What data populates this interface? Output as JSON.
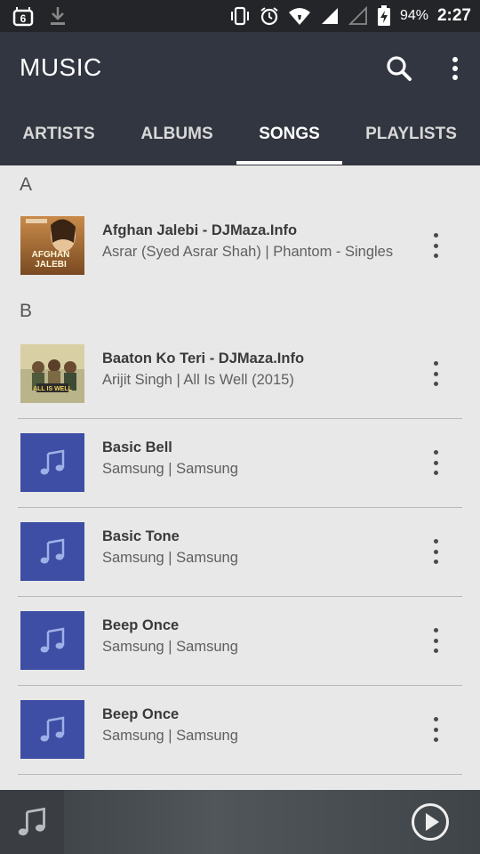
{
  "status_bar": {
    "battery": "94%",
    "time": "2:27",
    "icons": [
      "notification-6-icon",
      "download-icon",
      "vibrate-icon",
      "alarm-icon",
      "wifi-icon",
      "signal-icon",
      "signal-empty-icon",
      "battery-charging-icon"
    ]
  },
  "app_bar": {
    "title": "MUSIC",
    "icons": [
      "search-icon",
      "more-vert-icon"
    ],
    "tabs": [
      {
        "label": "ARTISTS"
      },
      {
        "label": "ALBUMS"
      },
      {
        "label": "SONGS",
        "active": true
      },
      {
        "label": "PLAYLISTS"
      }
    ]
  },
  "list": {
    "sections": [
      {
        "letter": "A"
      },
      {
        "letter": "B"
      }
    ],
    "songs": [
      {
        "title": "Afghan Jalebi - DJMaza.Info",
        "subtitle": "Asrar (Syed Asrar Shah) | Phantom - Singles",
        "art": "album-art",
        "art_text": "AFGHAN JALEBI"
      },
      {
        "title": "Baaton Ko Teri - DJMaza.Info",
        "subtitle": "Arijit Singh | All Is Well (2015)",
        "art": "album-art",
        "art_text": "ALL IS WELL"
      },
      {
        "title": "Basic Bell",
        "subtitle": "Samsung | Samsung",
        "art": "music-note-icon"
      },
      {
        "title": "Basic Tone",
        "subtitle": "Samsung | Samsung",
        "art": "music-note-icon"
      },
      {
        "title": "Beep Once",
        "subtitle": "Samsung | Samsung",
        "art": "music-note-icon"
      },
      {
        "title": "Beep Once",
        "subtitle": "Samsung | Samsung",
        "art": "music-note-icon"
      }
    ]
  },
  "mini_player": {
    "icons": [
      "music-note-icon",
      "play-icon"
    ]
  },
  "colors": {
    "app_bar": "#323640",
    "status_bar": "#232528",
    "list_background": "#e8e8e8",
    "placeholder_art": "#3d4ea4"
  }
}
